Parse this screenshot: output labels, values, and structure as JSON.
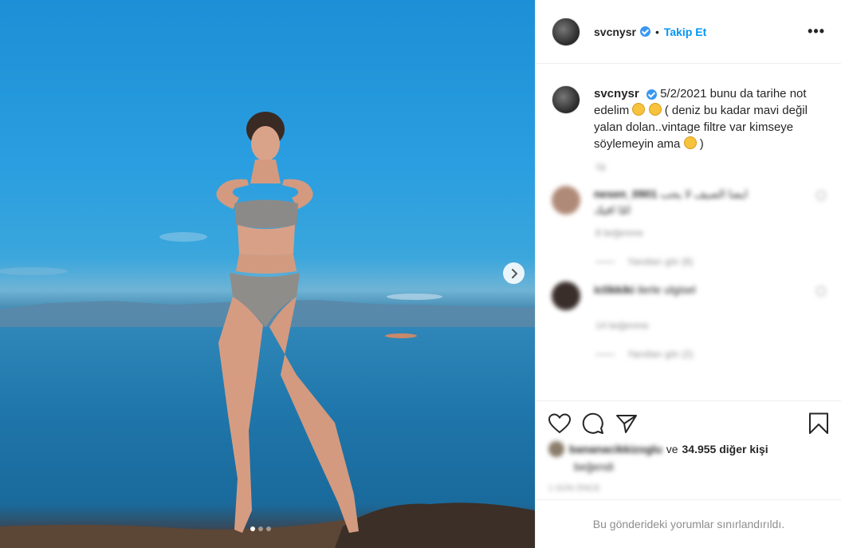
{
  "post": {
    "username": "svcnysr",
    "follow_label": "Takip Et",
    "bullet": "•",
    "more_label": "•••"
  },
  "caption": {
    "username": "svcnysr",
    "text_part1": "5/2/2021 bunu da tarihe not edelim",
    "text_part2": "( deniz bu kadar mavi değil yalan dolan..vintage filtre var kimseye söylemeyin ama",
    "text_part3": ")",
    "meta": "1g"
  },
  "comments": [
    {
      "user": "nesen_0901",
      "text": "ايضا الصيف لا يحب",
      "text2": "امّا افيك",
      "meta": "8 beğenme",
      "replies": "Yanıtları gör (8)",
      "avatar_color": "#b08a78"
    },
    {
      "user": "iclikkiki",
      "text": "ilerle ulgisel",
      "meta": "14 beğenme",
      "replies": "Yanıtları gör (2)",
      "avatar_color": "#3a2e2a"
    }
  ],
  "likes": {
    "liker": "bananacikkizoglu",
    "connector": "ve",
    "count_text": "34.955 diğer kişi",
    "sub": "beğendi"
  },
  "time_label": "1 GÜN ÖNCE",
  "comments_limited": "Bu gönderideki yorumlar sınırlandırıldı.",
  "colors": {
    "link": "#0095f6",
    "verified": "#3897f0",
    "muted": "#8e8e8e"
  },
  "icons": [
    "verified-icon",
    "more-icon",
    "next-arrow-icon",
    "heart-icon",
    "comment-icon",
    "share-icon",
    "bookmark-icon"
  ]
}
